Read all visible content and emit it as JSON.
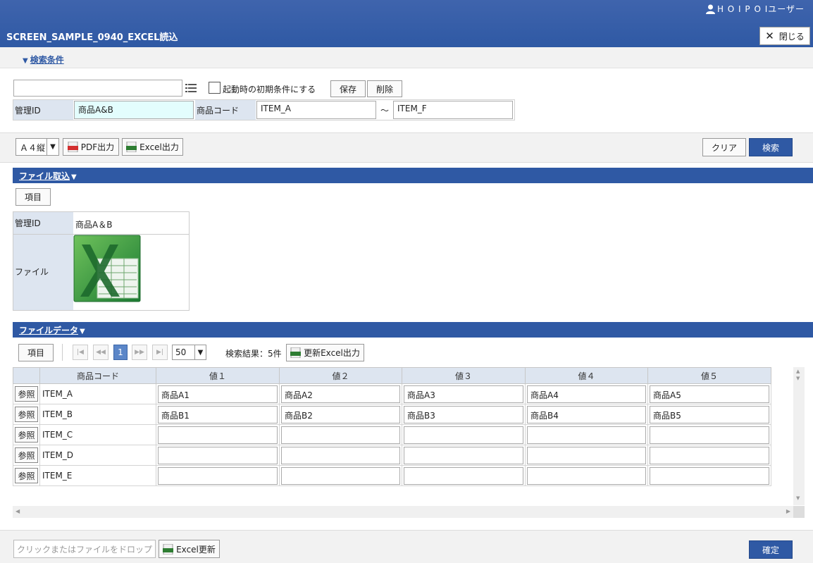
{
  "header": {
    "user_name": "H O I P O Iユーザー",
    "screen_title": "SCREEN_SAMPLE_0940_EXCEL読込",
    "close_label": "閉じる"
  },
  "search": {
    "toggle_label": "検索条件",
    "query_value": "",
    "startup_checkbox_label": "起動時の初期条件にする",
    "save_label": "保存",
    "delete_label": "削除",
    "kanri_id_label": "管理ID",
    "kanri_id_value": "商品A&B",
    "item_code_label": "商品コード",
    "item_code_from": "ITEM_A",
    "range_sep": "～",
    "item_code_to": "ITEM_F"
  },
  "toolbar": {
    "paper_value": "Ａ４縦",
    "pdf_label": "PDF出力",
    "excel_label": "Excel出力",
    "clear_label": "クリア",
    "search_label": "検索"
  },
  "file_import": {
    "section_label": "ファイル取込",
    "items_label": "項目",
    "kanri_id_label": "管理ID",
    "kanri_id_value": "商品A＆B",
    "file_label": "ファイル"
  },
  "file_data": {
    "section_label": "ファイルデータ",
    "items_label": "項目",
    "current_page": "1",
    "page_size": "50",
    "result_text": "検索結果：5件",
    "update_excel_label": "更新Excel出力",
    "columns": [
      "商品コード",
      "値１",
      "値２",
      "値３",
      "値４",
      "値５"
    ],
    "ref_label": "参照",
    "rows": [
      {
        "code": "ITEM_A",
        "values": [
          "商品A1",
          "商品A2",
          "商品A3",
          "商品A4",
          "商品A5"
        ]
      },
      {
        "code": "ITEM_B",
        "values": [
          "商品B1",
          "商品B2",
          "商品B3",
          "商品B4",
          "商品B5"
        ]
      },
      {
        "code": "ITEM_C",
        "values": [
          "",
          "",
          "",
          "",
          ""
        ]
      },
      {
        "code": "ITEM_D",
        "values": [
          "",
          "",
          "",
          "",
          ""
        ]
      },
      {
        "code": "ITEM_E",
        "values": [
          "",
          "",
          "",
          "",
          ""
        ]
      }
    ]
  },
  "footer": {
    "drop_label": "クリックまたはファイルをドロップ",
    "excel_update_label": "Excel更新",
    "confirm_label": "確定"
  },
  "colors": {
    "header_blue": "#2f59a4",
    "label_bg": "#dde5f0",
    "highlight_input": "#e3fdfd"
  }
}
